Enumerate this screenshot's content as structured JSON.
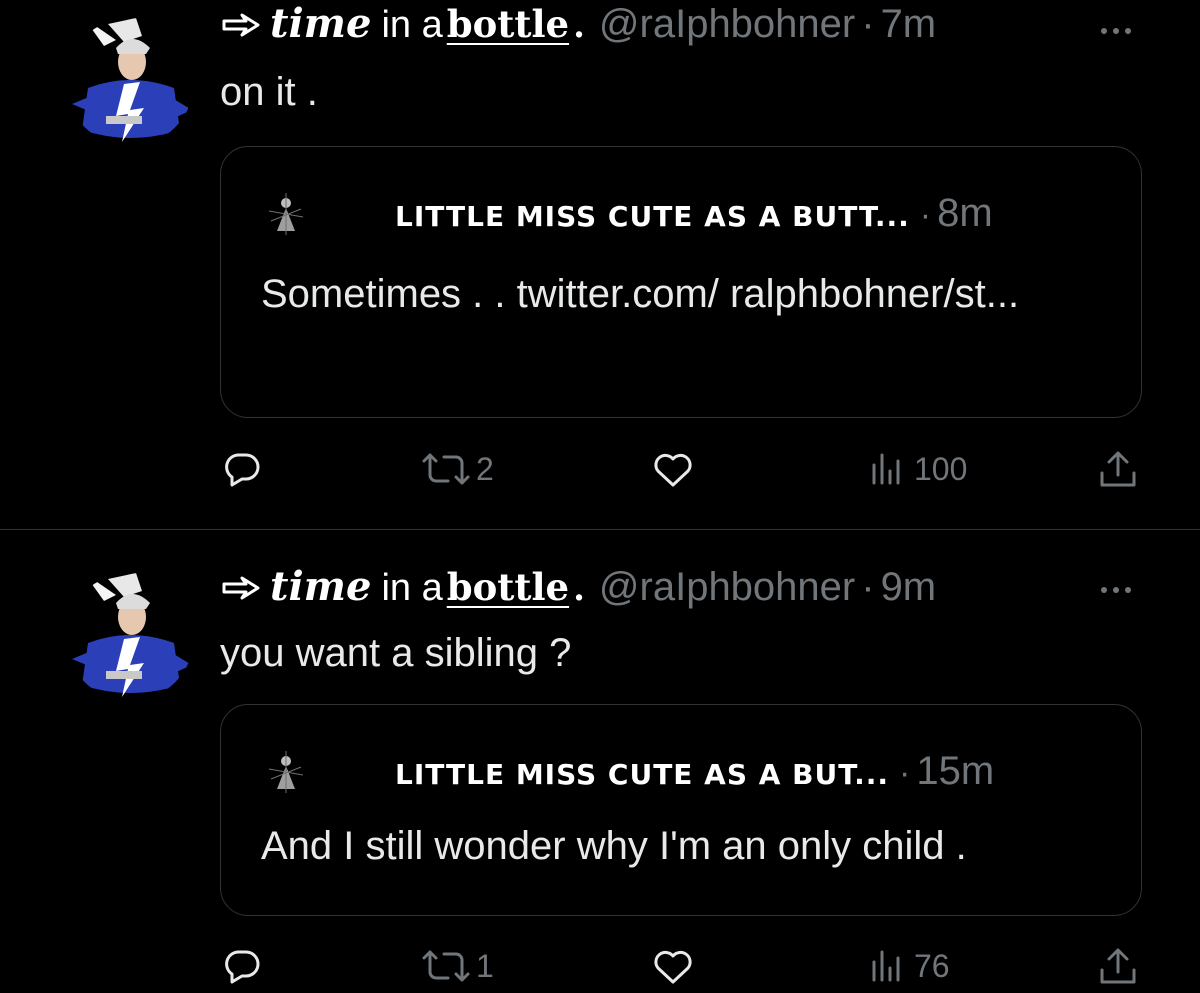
{
  "tweets": [
    {
      "author": {
        "name_part1": "time",
        "name_part2": "in a",
        "name_part3": "bottle",
        "name_part4": ".",
        "handle": "@raIphbohner",
        "separator": "·",
        "time": "7m"
      },
      "text": "on it .",
      "quote": {
        "name": "LITTLE MISS CUTE AS A BUTT...",
        "separator": "·",
        "time": "8m",
        "text": "Sometimes . . twitter.com/ ralphbohner/st..."
      },
      "actions": {
        "reply_icon": "reply-icon",
        "retweet_count": "2",
        "like_icon": "heart-icon",
        "views_count": "100",
        "share_icon": "share-icon"
      }
    },
    {
      "author": {
        "name_part1": "time",
        "name_part2": "in a",
        "name_part3": "bottle",
        "name_part4": ".",
        "handle": "@raIphbohner",
        "separator": "·",
        "time": "9m"
      },
      "text": "you want a sibling ?",
      "quote": {
        "name": "LITTLE MISS CUTE AS A BUT...",
        "separator": "·",
        "time": "15m",
        "text": "And I still wonder why I'm an only child ."
      },
      "actions": {
        "reply_icon": "reply-icon",
        "retweet_count": "1",
        "like_icon": "heart-icon",
        "views_count": "76",
        "share_icon": "share-icon"
      }
    }
  ],
  "colors": {
    "background": "#000000",
    "text_primary": "#e7e9ea",
    "text_secondary": "#71767b",
    "border": "#2f3336",
    "avatar_blue": "#2a3fb8"
  }
}
